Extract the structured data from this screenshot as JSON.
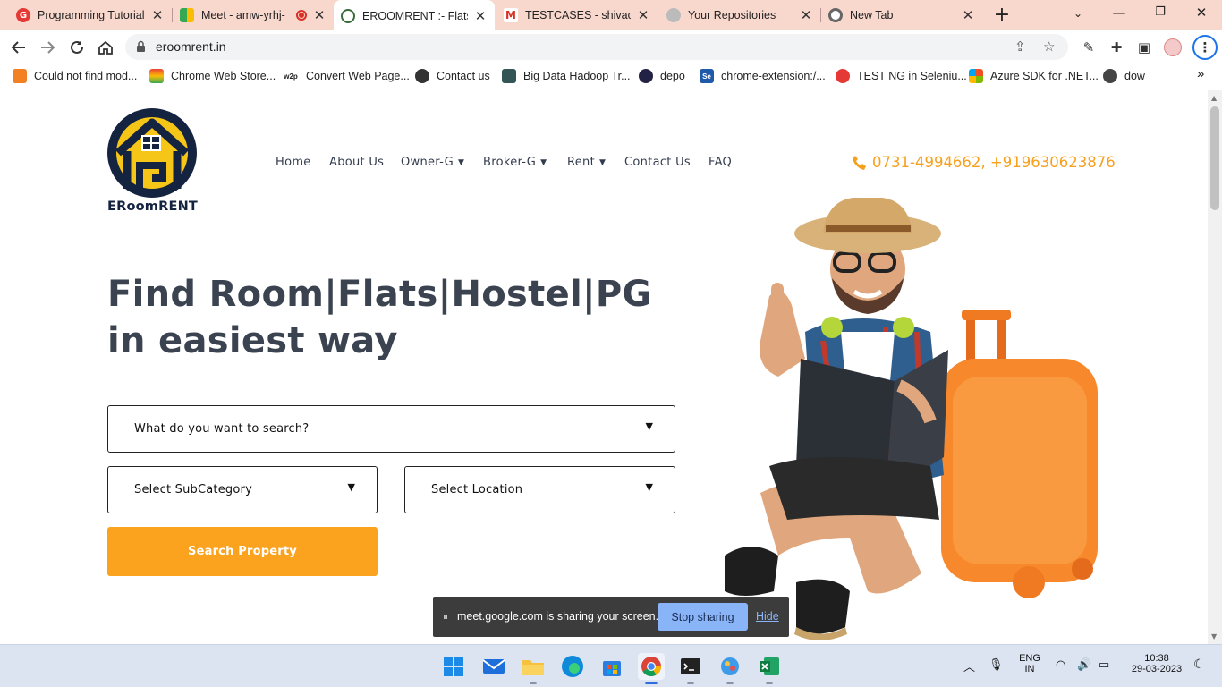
{
  "browser": {
    "tabs": [
      {
        "title": "Programming Tutorial",
        "favicon": "geeks-red-icon",
        "active": false
      },
      {
        "title": "Meet - amw-yrhj-",
        "favicon": "google-meet-icon",
        "active": false,
        "recording": true
      },
      {
        "title": "EROOMRENT :- Flats, I",
        "favicon": "eroomrent-icon",
        "active": true
      },
      {
        "title": "TESTCASES - shivacon",
        "favicon": "gmail-icon",
        "active": false
      },
      {
        "title": "Your Repositories",
        "favicon": "github-icon",
        "active": false
      },
      {
        "title": "New Tab",
        "favicon": "chrome-icon",
        "active": false
      }
    ],
    "url": "eroomrent.in",
    "bookmarks": [
      {
        "label": "Could not find mod...",
        "icon": "stackoverflow-icon"
      },
      {
        "label": "Chrome Web Store...",
        "icon": "webstore-icon"
      },
      {
        "label": "Convert Web Page...",
        "icon": "w2p-icon"
      },
      {
        "label": "Contact us",
        "icon": "globe-icon"
      },
      {
        "label": "Big Data Hadoop Tr...",
        "icon": "hadoop-icon"
      },
      {
        "label": "depo",
        "icon": "depo-icon"
      },
      {
        "label": "chrome-extension:/...",
        "icon": "selenium-icon"
      },
      {
        "label": "TEST NG in Seleniu...",
        "icon": "geeks-red-icon"
      },
      {
        "label": "Azure SDK for .NET...",
        "icon": "microsoft-icon"
      },
      {
        "label": "dow",
        "icon": "dow-icon"
      }
    ],
    "bookmarks_more": "»"
  },
  "site": {
    "logo_text": "ERoomRENT",
    "nav": [
      {
        "label": "Home",
        "dropdown": false
      },
      {
        "label": "About Us",
        "dropdown": false
      },
      {
        "label": "Owner-G",
        "dropdown": true
      },
      {
        "label": "Broker-G",
        "dropdown": true
      },
      {
        "label": "Rent",
        "dropdown": true
      },
      {
        "label": "Contact Us",
        "dropdown": false
      },
      {
        "label": "FAQ",
        "dropdown": false
      }
    ],
    "phone": "0731-4994662, +919630623876",
    "hero_line1": "Find Room|Flats|Hostel|PG",
    "hero_line2": "in easiest way",
    "search_what": "What do you want to search?",
    "select_subcategory": "Select SubCategory",
    "select_location": "Select Location",
    "search_button": "Search Property"
  },
  "sharing_bar": {
    "message": "meet.google.com is sharing your screen.",
    "stop_label": "Stop sharing",
    "hide_label": "Hide"
  },
  "taskbar": {
    "lang_top": "ENG",
    "lang_bottom": "IN",
    "time": "10:38",
    "date": "29-03-2023"
  },
  "colors": {
    "accent_orange": "#fba21e",
    "heading_dark": "#3b4351",
    "logo_navy": "#14233f",
    "logo_yellow": "#f5c518",
    "tab_strip": "#f8d7cd"
  }
}
